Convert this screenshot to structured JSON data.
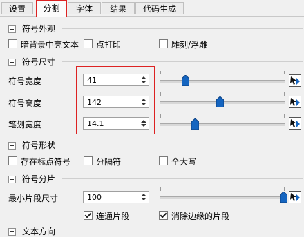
{
  "tabs": [
    {
      "label": "设置"
    },
    {
      "label": "分割"
    },
    {
      "label": "字体"
    },
    {
      "label": "结果"
    },
    {
      "label": "代码生成"
    }
  ],
  "accent_blue": "#1565c0",
  "highlight_red": "#dd2222",
  "sections": {
    "appearance": {
      "title": "符号外观",
      "options": [
        {
          "label": "暗背景中亮文本",
          "checked": false
        },
        {
          "label": "点打印",
          "checked": false
        },
        {
          "label": "雕刻/浮雕",
          "checked": false
        }
      ]
    },
    "size": {
      "title": "符号尺寸",
      "rows": [
        {
          "label": "符号宽度",
          "value": "41",
          "slider_fraction": 0.2
        },
        {
          "label": "符号高度",
          "value": "142",
          "slider_fraction": 0.48
        },
        {
          "label": "笔划宽度",
          "value": "14.1",
          "slider_fraction": 0.28
        }
      ]
    },
    "shape": {
      "title": "符号形状",
      "options": [
        {
          "label": "存在标点符号",
          "checked": false
        },
        {
          "label": "分隔符",
          "checked": false
        },
        {
          "label": "全大写",
          "checked": false
        }
      ]
    },
    "fragment": {
      "title": "符号分片",
      "min_label": "最小片段尺寸",
      "min_value": "100",
      "slider_fraction": 0.99,
      "options": [
        {
          "label": "连通片段",
          "checked": true
        },
        {
          "label": "消除边缘的片段",
          "checked": true
        }
      ]
    },
    "next": {
      "title": "文本方向"
    }
  }
}
